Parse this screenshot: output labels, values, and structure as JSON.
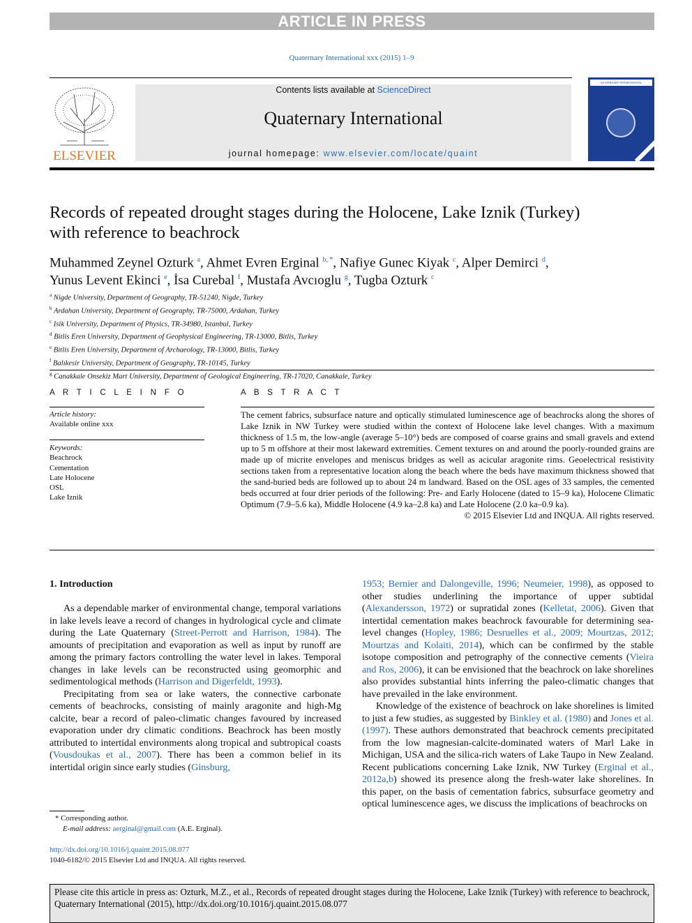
{
  "banner": "ARTICLE IN PRESS",
  "journal_ref": "Quaternary International xxx (2015) 1–9",
  "header": {
    "contents_prefix": "Contents lists available at ",
    "contents_link": "ScienceDirect",
    "journal_title": "Quaternary International",
    "homepage_prefix": "journal homepage: ",
    "homepage_link": "www.elsevier.com/locate/quaint",
    "publisher_logo": "ELSEVIER",
    "cover_title": "QUATERNARY INTERNATIONAL"
  },
  "article": {
    "title": "Records of repeated drought stages during the Holocene, Lake Iznik (Turkey) with reference to beachrock",
    "authors": [
      {
        "name": "Muhammed Zeynel Ozturk",
        "sup": "a"
      },
      {
        "name": "Ahmet Evren Erginal",
        "sup": "b, *"
      },
      {
        "name": "Nafiye Gunec Kiyak",
        "sup": "c"
      },
      {
        "name": "Alper Demirci",
        "sup": "d"
      },
      {
        "name": "Yunus Levent Ekinci",
        "sup": "e"
      },
      {
        "name": "İsa Curebal",
        "sup": "f"
      },
      {
        "name": "Mustafa Avcıoglu",
        "sup": "g"
      },
      {
        "name": "Tugba Ozturk",
        "sup": "c"
      }
    ],
    "affiliations": [
      {
        "sup": "a",
        "text": "Nigde University, Department of Geography, TR-51240, Nigde, Turkey"
      },
      {
        "sup": "b",
        "text": "Ardahan University, Department of Geography, TR-75000, Ardahan, Turkey"
      },
      {
        "sup": "c",
        "text": "Isik University, Department of Physics, TR-34980, Istanbul, Turkey"
      },
      {
        "sup": "d",
        "text": "Bitlis Eren University, Department of Geophysical Engineering, TR-13000, Bitlis, Turkey"
      },
      {
        "sup": "e",
        "text": "Bitlis Eren University, Department of Archaeology, TR-13000, Bitlis, Turkey"
      },
      {
        "sup": "f",
        "text": "Balıkesir University, Department of Geography, TR-10145, Turkey"
      },
      {
        "sup": "g",
        "text": "Canakkale Onsekiz Mart University, Department of Geological Engineering, TR-17020, Canakkale, Turkey"
      }
    ]
  },
  "article_info": {
    "heading": "A R T I C L E   I N F O",
    "history_label": "Article history:",
    "history_value": "Available online xxx",
    "keywords_label": "Keywords:",
    "keywords": [
      "Beachrock",
      "Cementation",
      "Late Holocene",
      "OSL",
      "Lake Iznik"
    ]
  },
  "abstract": {
    "heading": "A B S T R A C T",
    "text": "The cement fabrics, subsurface nature and optically stimulated luminescence age of beachrocks along the shores of Lake Iznik in NW Turkey were studied within the context of Holocene lake level changes. With a maximum thickness of 1.5 m, the low-angle (average 5–10°) beds are composed of coarse grains and small gravels and extend up to 5 m offshore at their most lakeward extremities. Cement textures on and around the poorly-rounded grains are made up of micrite envelopes and meniscus bridges as well as acicular aragonite rims. Geoelectrical resistivity sections taken from a representative location along the beach where the beds have maximum thickness showed that the sand-buried beds are followed up to about 24 m landward. Based on the OSL ages of 33 samples, the cemented beds occurred at four drier periods of the following: Pre- and Early Holocene (dated to 15–9 ka), Holocene Climatic Optimum (7.9–5.6 ka), Middle Holocene (4.9 ka–2.8 ka) and Late Holocene (2.0 ka–0.9 ka).",
    "copyright": "© 2015 Elsevier Ltd and INQUA. All rights reserved."
  },
  "body": {
    "section_heading": "1.  Introduction",
    "left": [
      [
        {
          "t": "As a dependable marker of environmental change, temporal variations in lake levels leave a record of changes in hydrological cycle and climate during the Late Quaternary ("
        },
        {
          "t": "Street-Perrott and Harrison, 1984",
          "link": true
        },
        {
          "t": "). The amounts of precipitation and evaporation as well as input by runoff are among the primary factors controlling the water level in lakes. Temporal changes in lake levels can be reconstructed using geomorphic and sedimentological methods ("
        },
        {
          "t": "Harrison and Digerfeldt, 1993",
          "link": true
        },
        {
          "t": ")."
        }
      ],
      [
        {
          "t": "Precipitating from sea or lake waters, the connective carbonate cements of beachrocks, consisting of mainly aragonite and high-Mg calcite, bear a record of paleo-climatic changes favoured by increased evaporation under dry climatic conditions. Beachrock has been mostly attributed to intertidal environments along tropical and subtropical coasts ("
        },
        {
          "t": "Vousdoukas et al., 2007",
          "link": true
        },
        {
          "t": "). There has been a common belief in its intertidal origin since early studies ("
        },
        {
          "t": "Ginsburg,",
          "link": true
        }
      ]
    ],
    "right": [
      [
        {
          "t": "1953; Bernier and Dalongeville, 1996; Neumeier, 1998",
          "link": true
        },
        {
          "t": "), as opposed to other studies underlining the importance of upper subtidal ("
        },
        {
          "t": "Alexandersson, 1972",
          "link": true
        },
        {
          "t": ") or supratidal zones ("
        },
        {
          "t": "Kelletat, 2006",
          "link": true
        },
        {
          "t": "). Given that intertidal cementation makes beachrock favourable for deter­mining sea-level changes ("
        },
        {
          "t": "Hopley, 1986; Desruelles et al., 2009; Mourtzas, 2012; Mourtzas and Kolaiti, 2014",
          "link": true
        },
        {
          "t": "), which can be confirmed by the stable isotope composition and petrography of the connective cements ("
        },
        {
          "t": "Vieira and Ros, 2006",
          "link": true
        },
        {
          "t": "), it can be envisioned that the beachrock on lake shorelines also provides substantial hints inferring the paleo-climatic changes that have prevailed in the lake environment."
        }
      ],
      [
        {
          "t": "Knowledge of the existence of beachrock on lake shorelines is limited to just a few studies, as suggested by "
        },
        {
          "t": "Binkley et al. (1980)",
          "link": true
        },
        {
          "t": " and "
        },
        {
          "t": "Jones et al. (1997)",
          "link": true
        },
        {
          "t": ". These authors demonstrated that beach­rock cements precipitated from the low magnesian-calcite-dominated waters of Marl Lake in Michigan, USA and the silica-rich waters of Lake Taupo in New Zealand. Recent publications concerning Lake Iznik, NW Turkey ("
        },
        {
          "t": "Erginal et al., 2012a,b",
          "link": true
        },
        {
          "t": ") showed its presence along the fresh-water lake shorelines. In this paper, on the basis of cementation fabrics, subsurface geometry and optical luminescence ages, we discuss the implications of beachrocks on"
        }
      ]
    ]
  },
  "footnote": {
    "star": "*",
    "corresponding": "Corresponding author.",
    "email_label": "E-mail address:",
    "email": "aerginal@gmail.com",
    "email_name": "(A.E. Erginal)."
  },
  "doi": "http://dx.doi.org/10.1016/j.quaint.2015.08.077",
  "issn": "1040-6182/© 2015 Elsevier Ltd and INQUA. All rights reserved.",
  "citation": "Please cite this article in press as: Ozturk, M.Z., et al., Records of repeated drought stages during the Holocene, Lake Iznik (Turkey) with reference to beachrock, Quaternary International (2015), http://dx.doi.org/10.1016/j.quaint.2015.08.077"
}
